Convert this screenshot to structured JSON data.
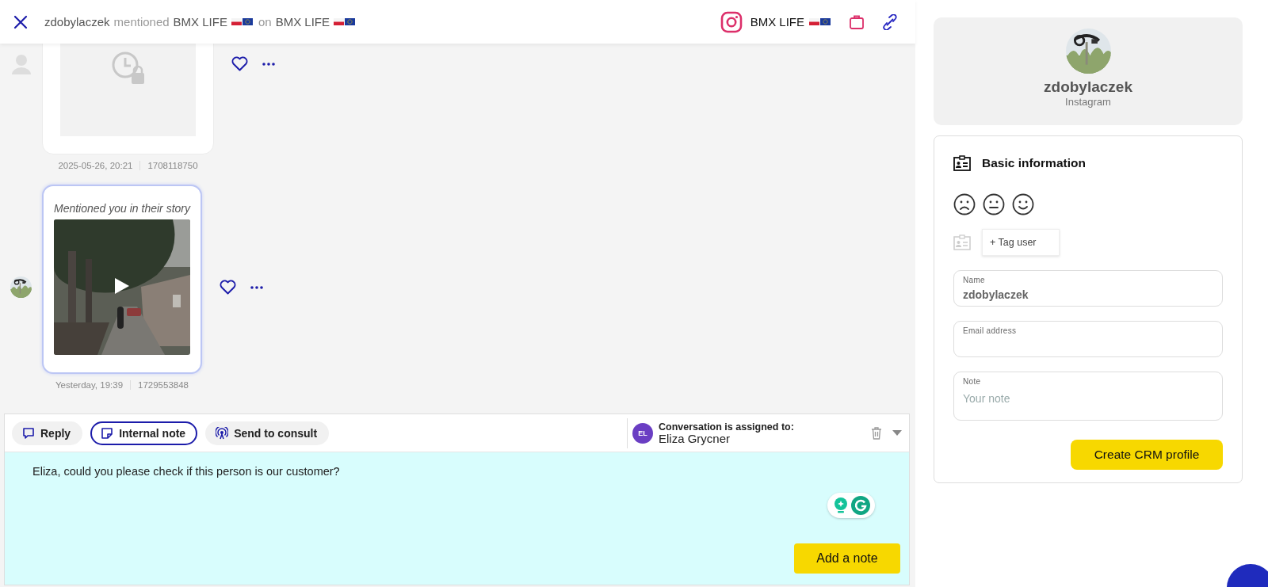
{
  "header": {
    "author": "zdobylaczek",
    "action": "mentioned",
    "target": "BMX LIFE",
    "preposition": "on",
    "account": "BMX LIFE"
  },
  "channel": {
    "name": "BMX LIFE"
  },
  "messages": [
    {
      "kind": "locked",
      "selected": false,
      "time": "2025-05-26, 20:21",
      "id": "1708118750"
    },
    {
      "kind": "story",
      "selected": true,
      "caption": "Mentioned you in their story",
      "time": "Yesterday, 19:39",
      "id": "1729553848"
    }
  ],
  "composer": {
    "tabs": [
      {
        "kind": "reply",
        "label": "Reply",
        "selected": false
      },
      {
        "kind": "note",
        "label": "Internal note",
        "selected": true
      },
      {
        "kind": "consult",
        "label": "Send to consult",
        "selected": false
      }
    ],
    "assignment": {
      "heading": "Conversation is assigned to:",
      "initials": "EL",
      "assignee": "Eliza Grycner"
    },
    "message_field": {
      "value": "Eliza, could you please check if this person is our customer?"
    },
    "submit": "Add a note"
  },
  "profile": {
    "name": "zdobylaczek",
    "network": "Instagram"
  },
  "basic_info": {
    "title": "Basic information",
    "tag_button": "+ Tag user",
    "fields": [
      {
        "label": "Name",
        "value": "zdobylaczek"
      },
      {
        "label": "Email address"
      },
      {
        "label": "Note",
        "placeholder": "Your note"
      }
    ],
    "button": "Create CRM profile"
  }
}
